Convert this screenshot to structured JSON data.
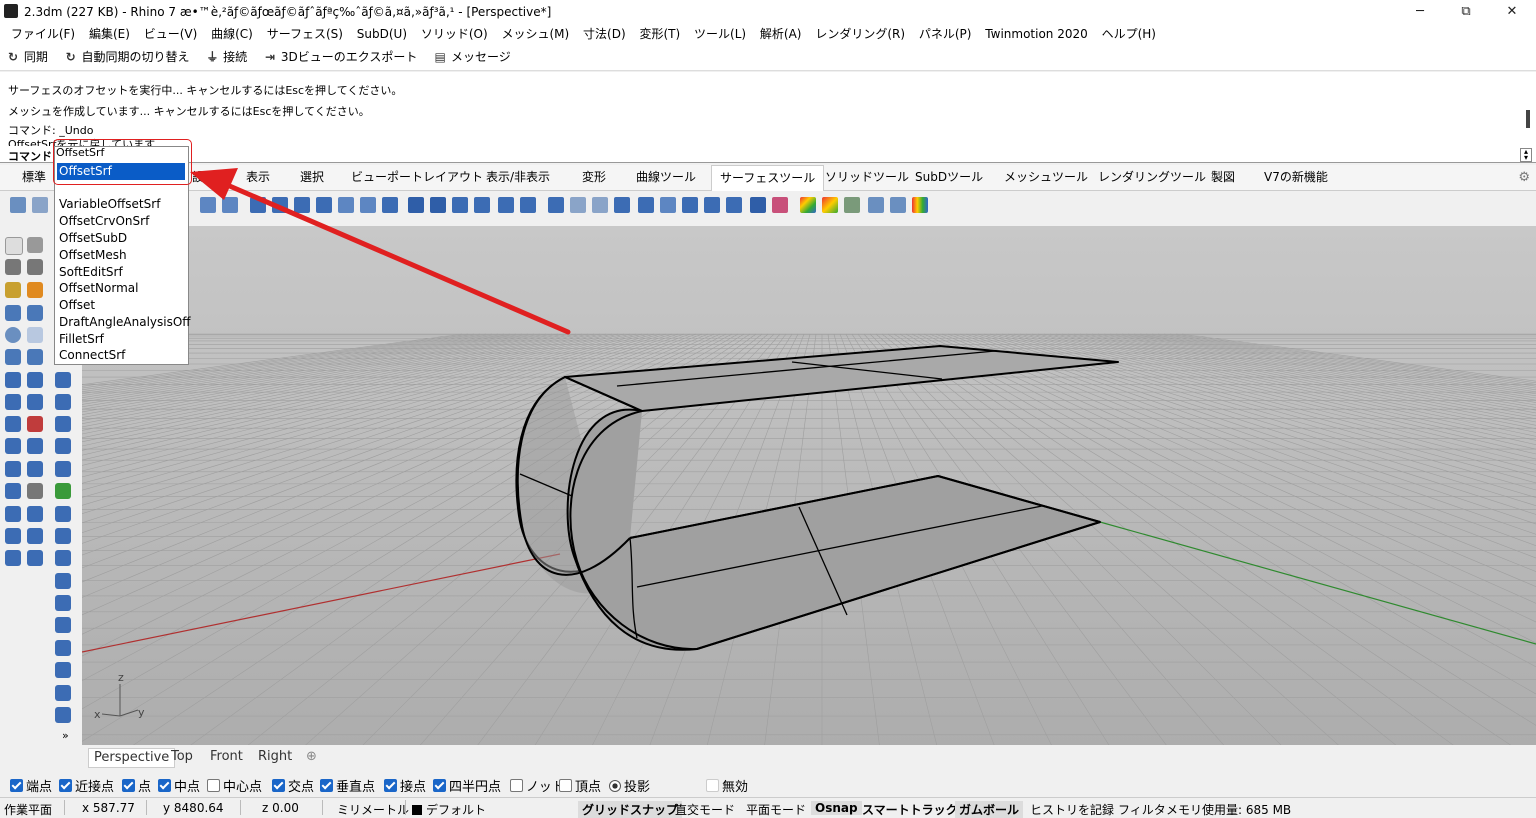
{
  "window": {
    "title": "2.3dm (227 KB) - Rhino 7 æ•™è‚²ãƒ©ãƒœãƒ©ãƒˆãƒªç‰ˆãƒ©ã‚¤ã‚»ãƒ³ã‚¹ - [Perspective*]",
    "minimize": "─",
    "maximize": "⧉",
    "close": "✕"
  },
  "menu": [
    "ファイル(F)",
    "編集(E)",
    "ビュー(V)",
    "曲線(C)",
    "サーフェス(S)",
    "SubD(U)",
    "ソリッド(O)",
    "メッシュ(M)",
    "寸法(D)",
    "変形(T)",
    "ツール(L)",
    "解析(A)",
    "レンダリング(R)",
    "パネル(P)",
    "Twinmotion 2020",
    "ヘルプ(H)"
  ],
  "sync": {
    "sync": "同期",
    "auto_sync": "自動同期の切り替え",
    "connect": "接続",
    "export3d": "3Dビューのエクスポート",
    "message": "メッセージ"
  },
  "history": {
    "line1": "サーフェスのオフセットを実行中... キャンセルするにはEscを押してください。",
    "line2": "メッシュを作成しています... キャンセルするにはEscを押してください。",
    "line3": "コマンド: _Undo",
    "line4": "OffsetSrfを元に戻しています"
  },
  "command": {
    "label": "コマンド:",
    "input": "OffsetSrf"
  },
  "tabs": [
    "標準",
    "設定",
    "表示",
    "選択",
    "ビューポートレイアウト",
    "表示/非表示",
    "変形",
    "曲線ツール",
    "サーフェスツール",
    "ソリッドツール",
    "SubDツール",
    "メッシュツール",
    "レンダリングツール",
    "製図",
    "V7の新機能"
  ],
  "active_tab": "サーフェスツール",
  "autocomplete": {
    "selected": "OffsetSrf",
    "items": [
      "VariableOffsetSrf",
      "OffsetCrvOnSrf",
      "OffsetSubD",
      "OffsetMesh",
      "SoftEditSrf",
      "OffsetNormal",
      "Offset",
      "DraftAngleAnalysisOff",
      "FilletSrf",
      "ConnectSrf"
    ]
  },
  "viewport_tabs": {
    "perspective": "Perspective",
    "top": "Top",
    "front": "Front",
    "right": "Right",
    "add": "⊕"
  },
  "axis": {
    "z": "z",
    "x": "x",
    "y": "y"
  },
  "more_tools": "»",
  "osnaps": [
    {
      "label": "端点",
      "checked": true
    },
    {
      "label": "近接点",
      "checked": true
    },
    {
      "label": "点",
      "checked": true
    },
    {
      "label": "中点",
      "checked": true
    },
    {
      "label": "中心点",
      "checked": false
    },
    {
      "label": "交点",
      "checked": true
    },
    {
      "label": "垂直点",
      "checked": true
    },
    {
      "label": "接点",
      "checked": true
    },
    {
      "label": "四半円点",
      "checked": true
    },
    {
      "label": "ノット",
      "checked": false
    },
    {
      "label": "頂点",
      "checked": false
    }
  ],
  "osnap_project": "投影",
  "osnap_disable": "無効",
  "status": {
    "cplane": "作業平面",
    "x": "x 587.77",
    "y": "y 8480.64",
    "z": "z 0.00",
    "units": "ミリメートル",
    "layer": "デフォルト",
    "grid_snap": "グリッドスナップ",
    "ortho": "直交モード",
    "planar": "平面モード",
    "osnap": "Osnap",
    "smart_track": "スマートトラック",
    "gumball": "ガムボール",
    "history": "ヒストリを記録",
    "filter": "フィルタ",
    "memory": "メモリ使用量: 685 MB"
  },
  "colors": {
    "highlight": "#0a5cc7",
    "annotation": "#e02020",
    "viewport_bg": "#b9b9b9"
  }
}
